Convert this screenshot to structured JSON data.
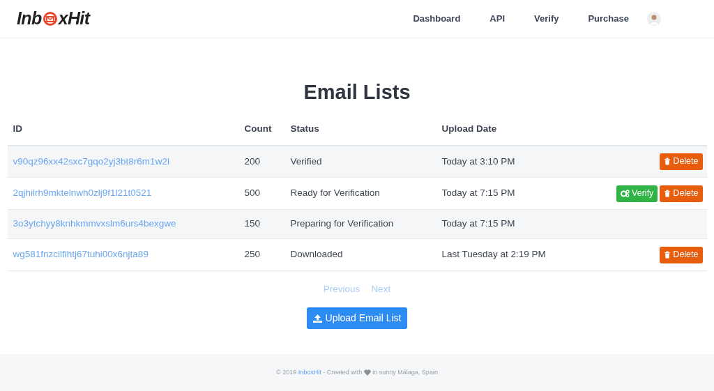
{
  "header": {
    "logo_left": "Inb",
    "logo_right": "xHit",
    "nav": [
      "Dashboard",
      "API",
      "Verify",
      "Purchase"
    ]
  },
  "title": "Email Lists",
  "table": {
    "columns": [
      "ID",
      "Count",
      "Status",
      "Upload Date"
    ],
    "rows": [
      {
        "id": "v90qz96xx42sxc7gqo2yj3bt8r6m1w2l",
        "count": "200",
        "status": "Verified",
        "date": "Today at 3:10 PM",
        "actions": [
          {
            "kind": "delete",
            "label": "Delete"
          }
        ]
      },
      {
        "id": "2qjhilrh9mktelnwh0zlj9f1l21t0521",
        "count": "500",
        "status": "Ready for Verification",
        "date": "Today at 7:15 PM",
        "actions": [
          {
            "kind": "verify",
            "label": "Verify"
          },
          {
            "kind": "delete",
            "label": "Delete"
          }
        ]
      },
      {
        "id": "3o3ytchyy8knhkmmvxslm6urs4bexgwe",
        "count": "150",
        "status": "Preparing for Verification",
        "date": "Today at 7:15 PM"
      },
      {
        "id": "wg581fnzcilfihtj67tuhi00x6njta89",
        "count": "250",
        "status": "Downloaded",
        "date": "Last Tuesday at 2:19 PM",
        "actions": [
          {
            "kind": "delete",
            "label": "Delete"
          }
        ]
      }
    ]
  },
  "pagination": [
    {
      "label": "Previous",
      "disabled": true
    },
    {
      "label": "Next",
      "disabled": true
    }
  ],
  "upload_button": "Upload Email List",
  "footer": {
    "before": "© 2019 ",
    "link": "InboxHit",
    "middle": " - Created with ",
    "after": " in sunny Málaga, Spain"
  }
}
